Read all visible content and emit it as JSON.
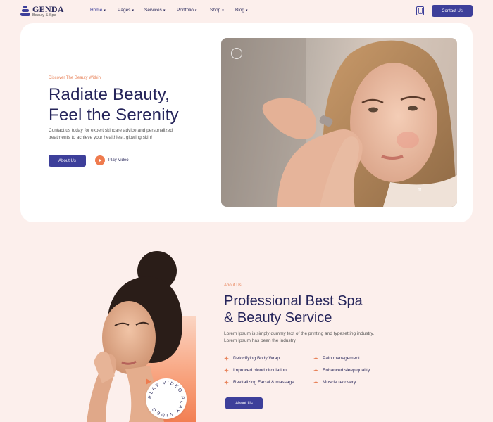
{
  "brand": {
    "name": "GENDA",
    "tagline": "Beauty & Spa",
    "accent": "#3d3f9a",
    "highlight": "#e8835a"
  },
  "nav": {
    "items": [
      {
        "label": "Home",
        "icon": "chevron-down-icon"
      },
      {
        "label": "Pages",
        "icon": "chevron-down-icon"
      },
      {
        "label": "Services",
        "icon": "chevron-down-icon"
      },
      {
        "label": "Portfolio",
        "icon": "chevron-down-icon"
      },
      {
        "label": "Shop",
        "icon": "chevron-down-icon"
      },
      {
        "label": "Blog",
        "icon": "chevron-down-icon"
      }
    ],
    "contact_label": "Contact Us",
    "phone_icon": "phone-icon"
  },
  "hero": {
    "kicker": "Discover The Beauty Within",
    "title_line1": "Radiate Beauty,",
    "title_line2": "Feel the Serenity",
    "description": "Contact us today for expert skincare advice and personalized treatments to achieve your healthiest, glowing skin!",
    "about_label": "About Us",
    "play_label": "Play Video",
    "slide_number": "01"
  },
  "about": {
    "kicker": "About Us",
    "title_line1": "Professional Best Spa",
    "title_line2": "& Beauty Service",
    "description": "Lorem Ipsum is simply dummy text of the printing and typesetting industry. Lorem Ipsum has been the industry",
    "features": [
      "Detoxifying Body Wrap",
      "Pain management",
      "Improved blood circulation",
      "Enhanced sleep quality",
      "Revitalizing Facial & massage",
      "Muscle recovery"
    ],
    "button_label": "About Us",
    "play_badge_text": "PLAY VIDEO PLAY VIDEO"
  }
}
